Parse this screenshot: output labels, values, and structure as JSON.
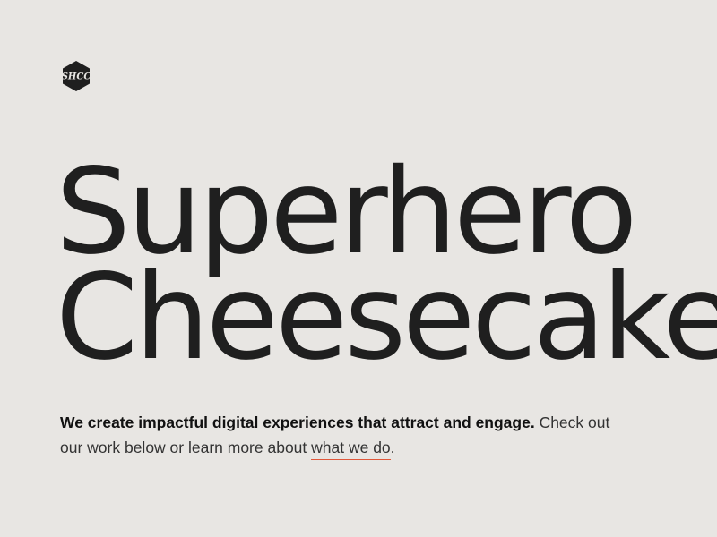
{
  "logo": {
    "text": "SHCC",
    "icon": "brand-logo-hexagon-icon",
    "color": "#1f1f1f"
  },
  "hero": {
    "line1": "Superhero",
    "line2": "Cheesecake"
  },
  "intro": {
    "bold_text": "We create impactful digital experiences that attract and engage.",
    "text_before_link": " Check out our work below or learn more about ",
    "link_text": "what we do",
    "text_after_link": "."
  },
  "colors": {
    "background": "#e8e6e3",
    "text": "#1f1f1f",
    "link_underline": "#e0573a"
  }
}
